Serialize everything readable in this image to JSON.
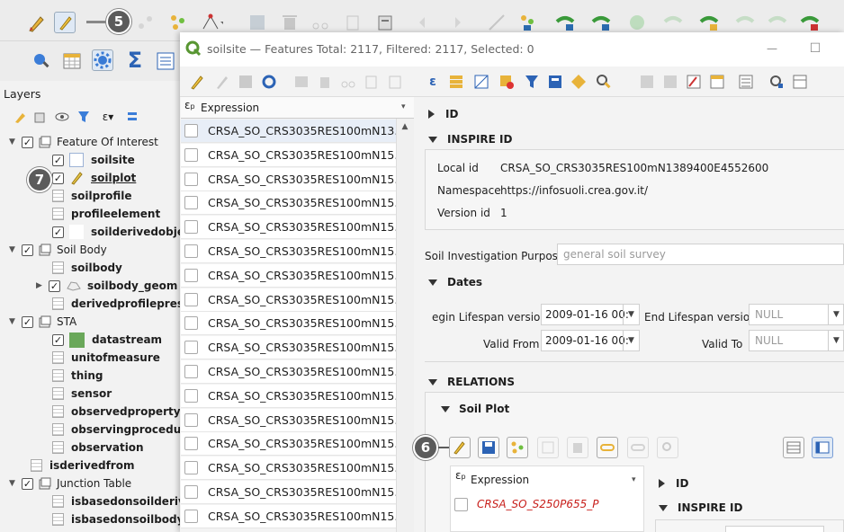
{
  "badges": {
    "b5": "5",
    "b6": "6",
    "b7": "7"
  },
  "layers_panel": {
    "title": "Layers",
    "items": [
      {
        "label": "Feature Of Interest",
        "kind": "group"
      },
      {
        "label": "soilsite",
        "kind": "layer"
      },
      {
        "label": "soilplot",
        "kind": "layer"
      },
      {
        "label": "soilprofile",
        "kind": "table"
      },
      {
        "label": "profileelement",
        "kind": "table"
      },
      {
        "label": "soilderivedobje",
        "kind": "layer"
      },
      {
        "label": "Soil Body",
        "kind": "group"
      },
      {
        "label": "soilbody",
        "kind": "table"
      },
      {
        "label": "soilbody_geom",
        "kind": "layer"
      },
      {
        "label": "derivedprofilepres",
        "kind": "table"
      },
      {
        "label": "STA",
        "kind": "group"
      },
      {
        "label": "datastream",
        "kind": "layer"
      },
      {
        "label": "unitofmeasure",
        "kind": "table"
      },
      {
        "label": "thing",
        "kind": "table"
      },
      {
        "label": "sensor",
        "kind": "table"
      },
      {
        "label": "observedproperty",
        "kind": "table"
      },
      {
        "label": "observingprocedur",
        "kind": "table"
      },
      {
        "label": "observation",
        "kind": "table"
      },
      {
        "label": "isderivedfrom",
        "kind": "table"
      },
      {
        "label": "Junction Table",
        "kind": "group"
      },
      {
        "label": "isbasedonsoilderive",
        "kind": "table"
      },
      {
        "label": "isbasedonsoilbody",
        "kind": "table"
      }
    ]
  },
  "dialog": {
    "title": "soilsite — Features Total: 2117, Filtered: 2117, Selected: 0",
    "minimize": "—",
    "maximize": "☐"
  },
  "feature_list": {
    "header": "Expression",
    "rows": [
      "CRSA_SO_CRS3035RES100mN13...",
      "CRSA_SO_CRS3035RES100mN15...",
      "CRSA_SO_CRS3035RES100mN15...",
      "CRSA_SO_CRS3035RES100mN15...",
      "CRSA_SO_CRS3035RES100mN15...",
      "CRSA_SO_CRS3035RES100mN15...",
      "CRSA_SO_CRS3035RES100mN15...",
      "CRSA_SO_CRS3035RES100mN15...",
      "CRSA_SO_CRS3035RES100mN15...",
      "CRSA_SO_CRS3035RES100mN15...",
      "CRSA_SO_CRS3035RES100mN15...",
      "CRSA_SO_CRS3035RES100mN15...",
      "CRSA_SO_CRS3035RES100mN15...",
      "CRSA_SO_CRS3035RES100mN15...",
      "CRSA_SO_CRS3035RES100mN15...",
      "CRSA_SO_CRS3035RES100mN15...",
      "CRSA_SO_CRS3035RES100mN15..."
    ]
  },
  "form": {
    "id_section": "ID",
    "inspire_section": "INSPIRE ID",
    "local_id_label": "Local id",
    "local_id_value": "CRSA_SO_CRS3035RES100mN1389400E4552600",
    "namespace_label": "Namespace",
    "namespace_value": "https://infosuoli.crea.gov.it/",
    "version_id_label": "Version id",
    "version_id_value": "1",
    "purpose_label": "Soil Investigation Purpose",
    "purpose_value": "general soil survey",
    "dates_section": "Dates",
    "begin_label": "egin Lifespan version",
    "begin_value": "2009-01-16 00:",
    "end_label": "End Lifespan version",
    "end_value": "NULL",
    "valid_from_label": "Valid From",
    "valid_from_value": "2009-01-16 00:",
    "valid_to_label": "Valid To",
    "valid_to_value": "NULL",
    "relations_section": "RELATIONS",
    "soil_plot_section": "Soil Plot",
    "sub_expression": "Expression",
    "sub_row": "CRSA_SO_S250P655_P",
    "sub_id": "ID",
    "sub_inspire": "INSPIRE ID"
  },
  "colors": {
    "accent": "#589632",
    "badge": "#5b5b5b",
    "selected_red": "#c8201c"
  }
}
